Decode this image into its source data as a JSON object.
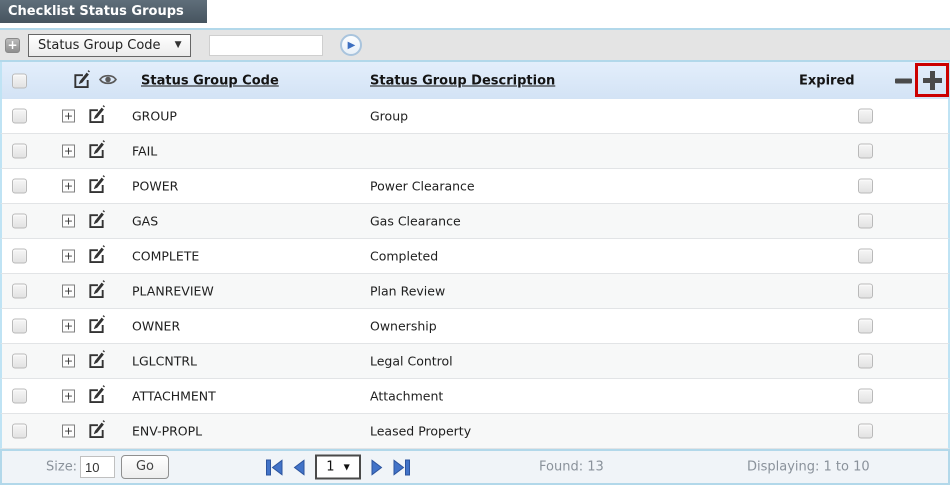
{
  "title": "Checklist Status Groups",
  "toolbar": {
    "add_icon": "+",
    "field_select": {
      "value": "Status Group Code",
      "arrow": "▼"
    },
    "search_value": "",
    "go_icon": "▶"
  },
  "table": {
    "header": {
      "code": "Status Group Code",
      "description": "Status Group Description",
      "expired": "Expired"
    },
    "expander_icon": "+",
    "rows": [
      {
        "code": "GROUP",
        "description": "Group"
      },
      {
        "code": "FAIL",
        "description": ""
      },
      {
        "code": "POWER",
        "description": "Power Clearance"
      },
      {
        "code": "GAS",
        "description": "Gas Clearance"
      },
      {
        "code": "COMPLETE",
        "description": "Completed"
      },
      {
        "code": "PLANREVIEW",
        "description": "Plan Review"
      },
      {
        "code": "OWNER",
        "description": "Ownership"
      },
      {
        "code": "LGLCNTRL",
        "description": "Legal Control"
      },
      {
        "code": "ATTACHMENT",
        "description": "Attachment"
      },
      {
        "code": "ENV-PROPL",
        "description": "Leased Property"
      }
    ]
  },
  "footer": {
    "size_label": "Size:",
    "size_value": "10",
    "go_label": "Go",
    "page_value": "1",
    "page_arrow": "▼",
    "found": "Found: 13",
    "displaying": "Displaying: 1 to 10"
  },
  "colors": {
    "title_bar": "#4d5c67",
    "toolbar_border": "#b2d8ea",
    "header_bg": "#d9e6f6",
    "highlight_red": "#cb0000",
    "pagination_blue": "#4273c8",
    "muted_text": "#8a929b"
  }
}
